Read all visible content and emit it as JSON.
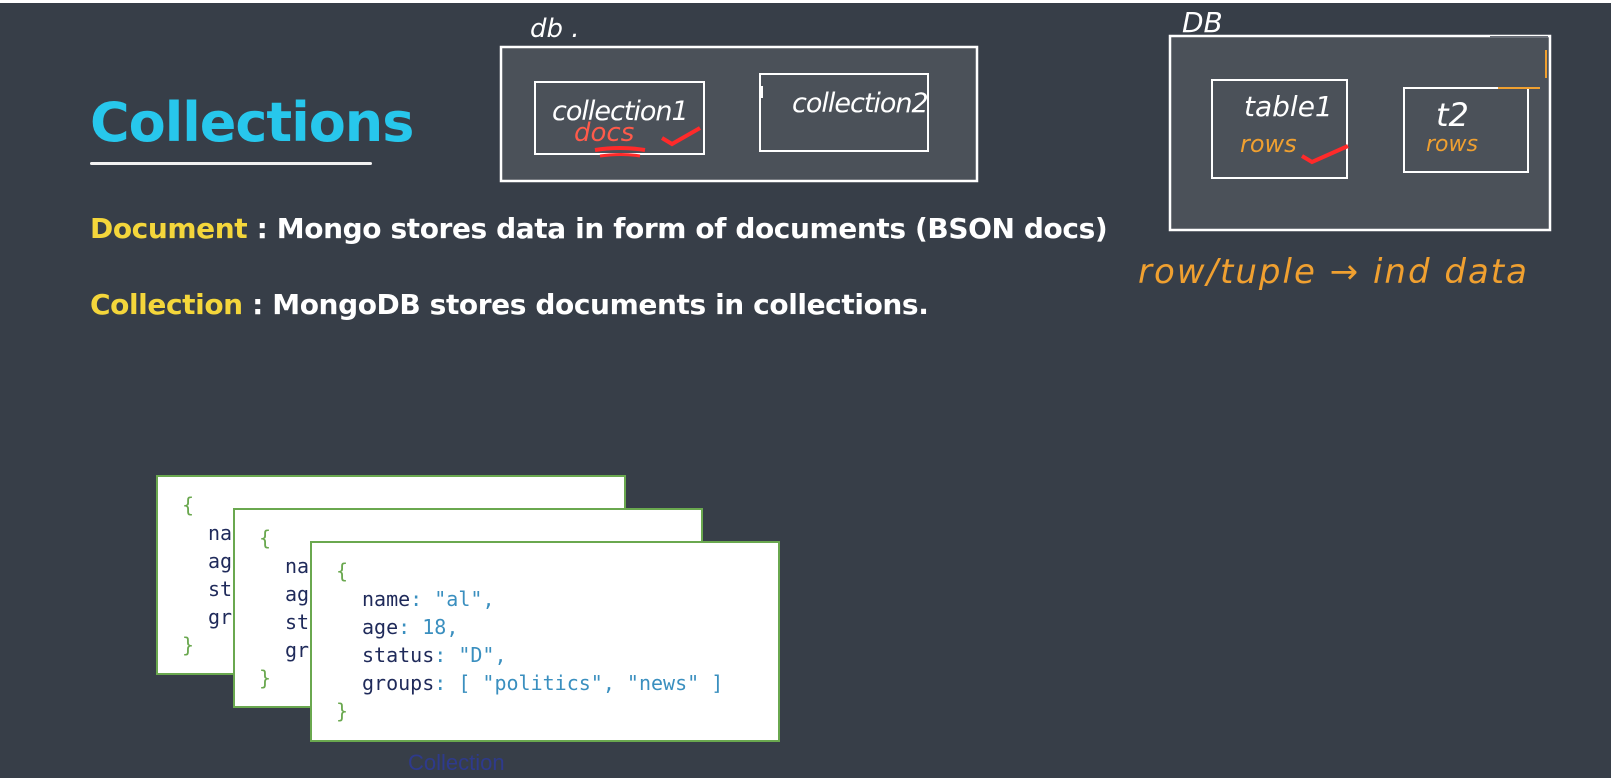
{
  "slide": {
    "title": "Collections",
    "definitions": [
      {
        "term": "Document",
        "separator": " : ",
        "text": "Mongo stores data in form of documents (BSON docs)"
      },
      {
        "term": "Collection",
        "separator": " : ",
        "text": "MongoDB stores documents in collections."
      }
    ]
  },
  "annotations": {
    "db_label": "db .",
    "collection1": "collection1",
    "collection1_sub": "docs",
    "collection2": "collection2",
    "db_label_right": "DB",
    "table1": "table1",
    "table1_sub": "rows",
    "table2": "t2",
    "table2_sub": "rows",
    "row_note": "row/tuple → ind data"
  },
  "colors": {
    "background": "#373e48",
    "title": "#27c7ec",
    "term": "#f4d63b",
    "handwriting_white": "#ffffff",
    "handwriting_orange": "#f0a030",
    "highlight_red": "#ff2a2a",
    "card_border": "#6aa84f"
  },
  "documents": {
    "back_cards": [
      {
        "brace_open": "{",
        "keys": [
          "na",
          "ag",
          "st",
          "gr"
        ],
        "brace_close": "}"
      },
      {
        "brace_open": "{",
        "keys": [
          "na",
          "ag",
          "st",
          "gr"
        ],
        "brace_close": "}"
      }
    ],
    "front_card": {
      "brace_open": "{",
      "fields": [
        {
          "key": "name",
          "sep": ": ",
          "value": "\"al\"",
          "trail": ","
        },
        {
          "key": "age",
          "sep": ": ",
          "value": "18",
          "trail": ","
        },
        {
          "key": "status",
          "sep": ": ",
          "value": "\"D\"",
          "trail": ","
        },
        {
          "key": "groups",
          "sep": ": ",
          "value": "[ \"politics\", \"news\" ]",
          "trail": ""
        }
      ],
      "brace_close": "}"
    },
    "caption": "Collection"
  }
}
